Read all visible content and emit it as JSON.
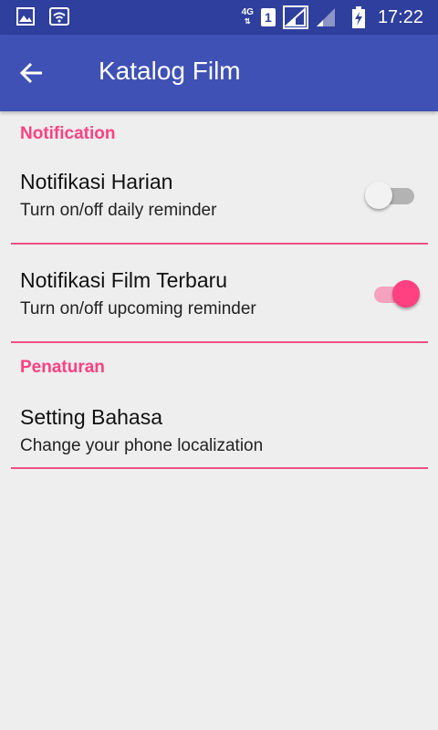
{
  "status_bar": {
    "network_type": "4G",
    "sim_slot": "1",
    "time": "17:22",
    "icons": [
      "gallery-icon",
      "wifi-icon",
      "signal-icon",
      "signal-weak-icon",
      "battery-charging-icon"
    ]
  },
  "app_bar": {
    "title": "Katalog Film",
    "back_icon": "arrow-back-icon"
  },
  "sections": [
    {
      "header": "Notification",
      "items": [
        {
          "title": "Notifikasi Harian",
          "summary": "Turn on/off daily reminder",
          "switch_on": false
        },
        {
          "title": "Notifikasi Film Terbaru",
          "summary": "Turn on/off upcoming reminder",
          "switch_on": true
        }
      ]
    },
    {
      "header": "Penaturan",
      "items": [
        {
          "title": "Setting Bahasa",
          "summary": "Change your phone localization"
        }
      ]
    }
  ],
  "colors": {
    "status_bar": "#2f3f9d",
    "app_bar": "#3f51b5",
    "accent": "#ff4081",
    "background": "#eeeeee"
  }
}
